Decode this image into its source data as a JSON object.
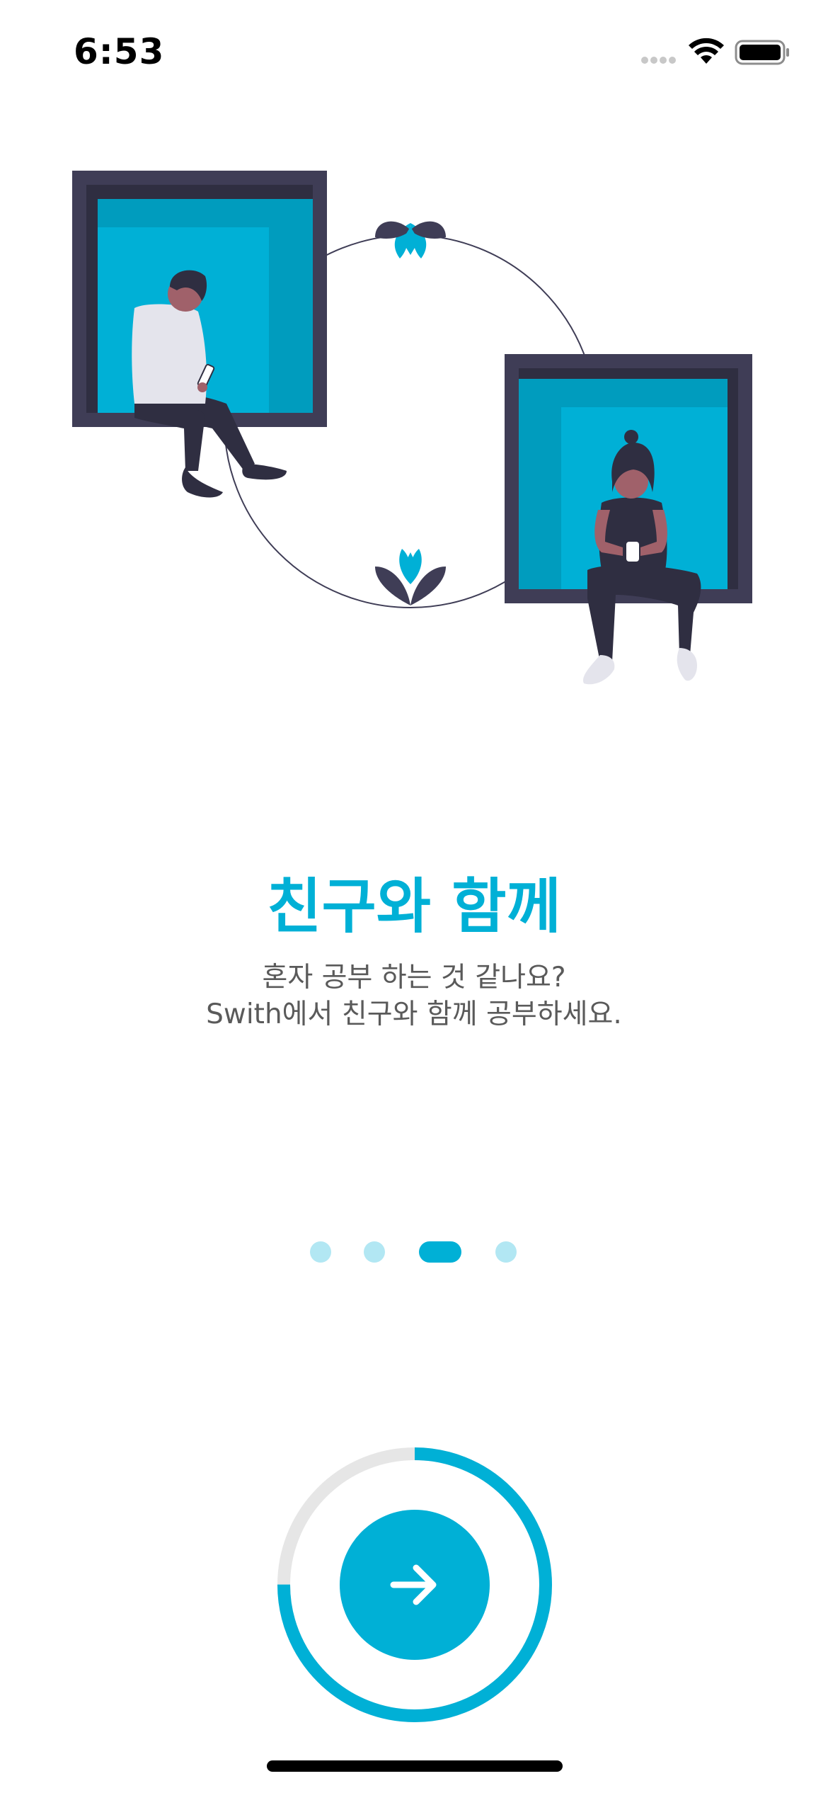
{
  "status_bar": {
    "time": "6:53",
    "icons": [
      "cellular-signal-icon",
      "wifi-icon",
      "battery-icon"
    ]
  },
  "illustration": {
    "name": "friends-studying-together-illustration"
  },
  "onboarding": {
    "title": "친구와 함께",
    "description_line1": "혼자 공부 하는 것 같나요?",
    "description_line2": "Swith에서 친구와 함께 공부하세요."
  },
  "pager": {
    "page_count": 4,
    "current_page": 3
  },
  "next_button": {
    "icon": "arrow-right-icon",
    "progress_fraction": 0.75
  },
  "colors": {
    "accent": "#00B0D6",
    "accent_light": "#B2E7F3",
    "dark": "#3F3D56",
    "text_gray": "#5a5a5a",
    "track_gray": "#E6E6E6"
  }
}
